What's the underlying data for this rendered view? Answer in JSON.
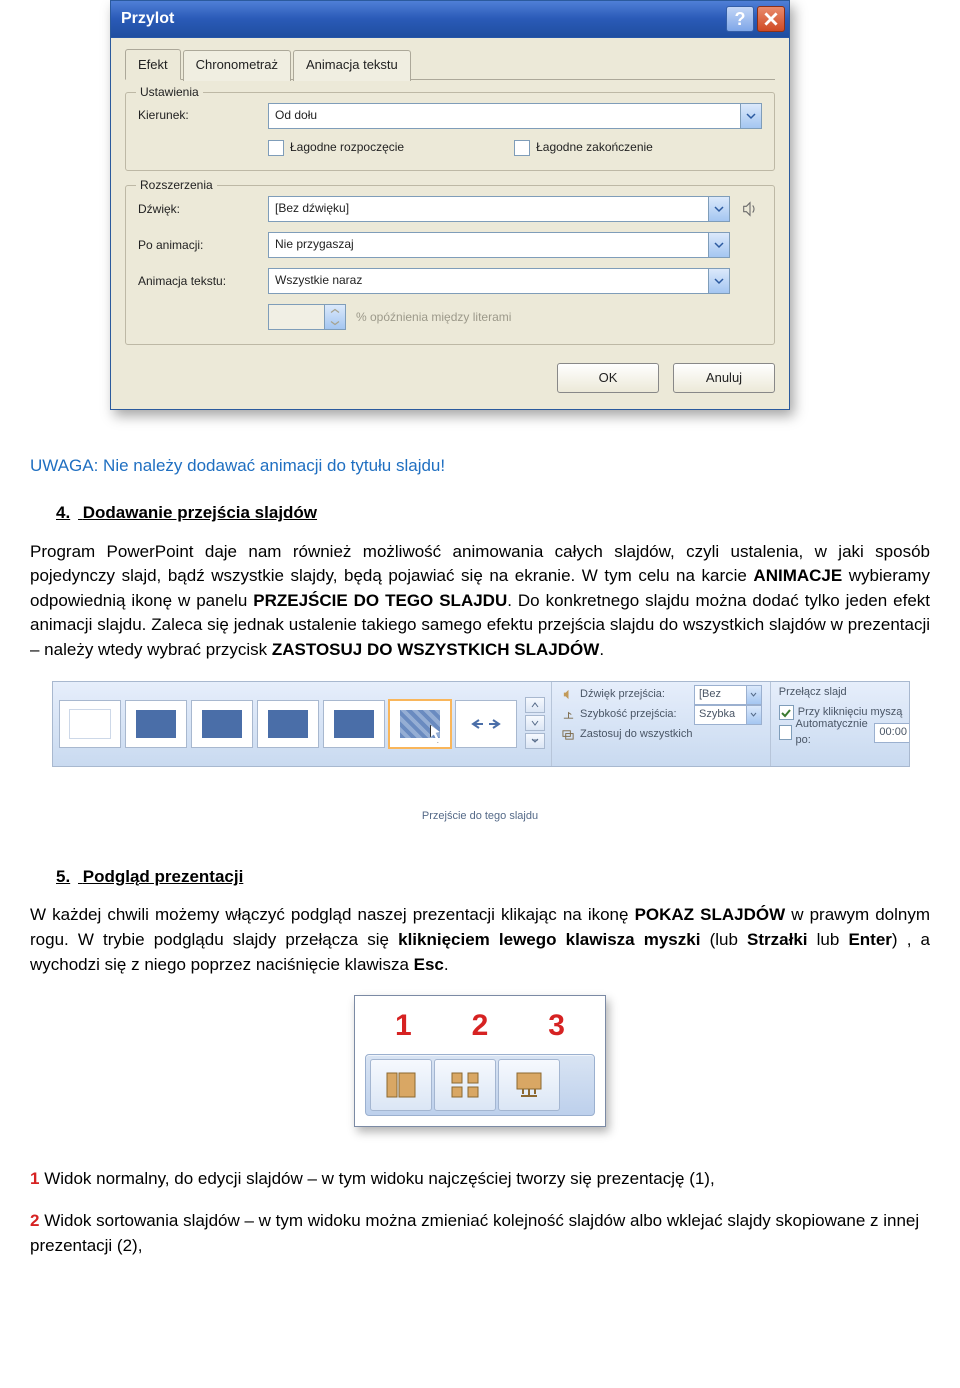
{
  "dialog": {
    "title": "Przylot",
    "help": "?",
    "tabs": [
      "Efekt",
      "Chronometraż",
      "Animacja tekstu"
    ],
    "group_settings": "Ustawienia",
    "group_ext": "Rozszerzenia",
    "kierunek_label": "Kierunek:",
    "kierunek_value": "Od dołu",
    "lagodne_rozp": "Łagodne rozpoczęcie",
    "lagodne_zak": "Łagodne zakończenie",
    "dzwiek_label": "Dźwięk:",
    "dzwiek_value": "[Bez dźwięku]",
    "po_label": "Po animacji:",
    "po_value": "Nie przygaszaj",
    "anim_label": "Animacja tekstu:",
    "anim_value": "Wszystkie naraz",
    "delay_label": "% opóźnienia między literami",
    "ok": "OK",
    "cancel": "Anuluj"
  },
  "doc": {
    "note": "UWAGA: Nie należy dodawać animacji do tytułu slajdu!",
    "h4_num": "4.",
    "h4": "Dodawanie przejścia slajdów",
    "para1_a": "Program PowerPoint daje nam również możliwość animowania całych slajdów, czyli ustalenia, w jaki sposób pojedynczy slajd, bądź wszystkie slajdy, będą pojawiać się na ekranie. W tym celu na karcie ",
    "para1_b": "ANIMACJE",
    "para1_c": " wybieramy odpowiednią ikonę w panelu ",
    "para1_d": "PRZEJŚCIE DO TEGO SLAJDU",
    "para1_e": ". Do konkretnego slajdu można dodać tylko jeden efekt animacji slajdu. Zaleca się jednak ustalenie takiego samego efektu przejścia slajdu do wszystkich slajdów w prezentacji – należy wtedy wybrać przycisk ",
    "para1_f": "ZASTOSUJ DO WSZYSTKICH SLAJDÓW",
    "para1_g": "."
  },
  "ribbon": {
    "caption": "Przejście do tego slajdu",
    "s1_label": "Dźwięk przejścia:",
    "s1_value": "[Bez dźwięku]",
    "s2_label": "Szybkość przejścia:",
    "s2_value": "Szybka",
    "s3_label": "Zastosuj do wszystkich",
    "adv_title": "Przełącz slajd",
    "adv_chk1": "Przy kliknięciu myszą",
    "adv_chk2": "Automatycznie po:",
    "adv_time": "00:00"
  },
  "sec5": {
    "num": "5.",
    "title": "Podgląd prezentacji",
    "para_a": "W każdej chwili możemy włączyć podgląd naszej prezentacji klikając na ikonę ",
    "para_b": "POKAZ SLAJDÓW",
    "para_c": " w prawym dolnym rogu. W trybie podglądu slajdy przełącza się ",
    "para_d": "kliknięciem lewego klawisza myszki",
    "para_e": " (lub ",
    "para_f": "Strzałki",
    "para_g": " lub ",
    "para_h": "Enter",
    "para_i": ") , a wychodzi się z niego poprzez naciśnięcie klawisza ",
    "para_j": "Esc",
    "para_k": "."
  },
  "viewnums": [
    "1",
    "2",
    "3"
  ],
  "lines": {
    "l1_num": "1",
    "l1_text": " Widok normalny, do edycji slajdów – w tym widoku najczęściej tworzy się prezentację (1),",
    "l2_num": "2",
    "l2_text": " Widok sortowania slajdów – w tym widoku można zmieniać kolejność slajdów albo wklejać slajdy skopiowane z innej prezentacji (2),"
  }
}
